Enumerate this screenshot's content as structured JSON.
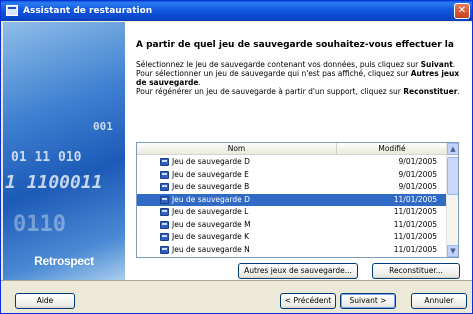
{
  "window": {
    "title": "Assistant de restauration"
  },
  "sidebar": {
    "digits": [
      "001",
      "01 11 010",
      "1 1100011",
      "0110"
    ],
    "logo": "Retrospect"
  },
  "main": {
    "heading": "A partir de quel jeu de sauvegarde souhaitez-vous effectuer la",
    "desc1": "Sélectionnez le jeu de sauvegarde contenant vos données, puis cliquez sur ",
    "desc1_bold": "Suivant",
    "desc2": "Pour sélectionner un jeu de sauvegarde qui n'est pas affiché, cliquez sur ",
    "desc2_bold": "Autres jeux de sauvegarde",
    "desc3": "Pour régénérer un jeu de sauvegarde à partir d'un support, cliquez sur ",
    "desc3_bold": "Reconstituer"
  },
  "list": {
    "columns": {
      "name": "Nom",
      "modified": "Modifié"
    },
    "rows": [
      {
        "name": "Jeu de sauvegarde D",
        "date": "9/01/2005"
      },
      {
        "name": "Jeu de sauvegarde E",
        "date": "9/01/2005"
      },
      {
        "name": "Jeu de sauvegarde B",
        "date": "9/01/2005"
      },
      {
        "name": "Jeu de sauvegarde  D",
        "date": "11/01/2005",
        "selected": true
      },
      {
        "name": "Jeu de sauvegarde L",
        "date": "11/01/2005"
      },
      {
        "name": "Jeu de sauvegarde M",
        "date": "11/01/2005"
      },
      {
        "name": "Jeu de sauvegarde K",
        "date": "11/01/2005"
      },
      {
        "name": "Jeu de sauvegarde N",
        "date": "11/01/2005"
      }
    ]
  },
  "buttons": {
    "other": "Autres jeux de sauvegarde...",
    "rebuild": "Reconstituer...",
    "help": "Aide",
    "prev": "< Précédent",
    "next": "Suivant >",
    "cancel": "Annuler"
  },
  "colors": {
    "titlebar": "#0a5ad6",
    "selection": "#316ac5",
    "chrome": "#ece9d8"
  }
}
